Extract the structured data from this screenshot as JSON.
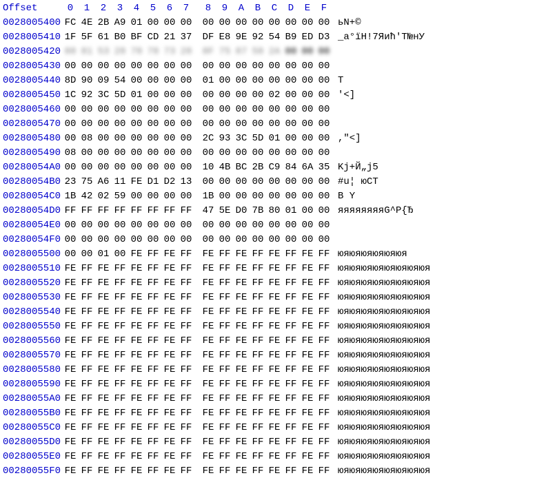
{
  "header": {
    "offset_label": "Offset",
    "cols": [
      "0",
      "1",
      "2",
      "3",
      "4",
      "5",
      "6",
      "7",
      "8",
      "9",
      "A",
      "B",
      "C",
      "D",
      "E",
      "F"
    ]
  },
  "rows": [
    {
      "offset": "0028005400",
      "bytes": [
        "FC",
        "4E",
        "2B",
        "A9",
        "01",
        "00",
        "00",
        "00",
        "00",
        "00",
        "00",
        "00",
        "00",
        "00",
        "00",
        "00"
      ],
      "ascii": "ьN+©",
      "blurred": false
    },
    {
      "offset": "0028005410",
      "bytes": [
        "1F",
        "5F",
        "61",
        "B0",
        "BF",
        "CD",
        "21",
        "37",
        "DF",
        "E8",
        "9E",
        "92",
        "54",
        "B9",
        "ED",
        "D3"
      ],
      "ascii": " _a°їН!7Яић'T№нУ",
      "blurred": false
    },
    {
      "offset": "0028005420",
      "bytes": [
        "88",
        "81",
        "53",
        "28",
        "78",
        "78",
        "73",
        "28",
        "8F",
        "75",
        "87",
        "58",
        "2A",
        "00",
        "00",
        "00"
      ],
      "ascii": "                ",
      "blurred": true
    },
    {
      "offset": "0028005430",
      "bytes": [
        "00",
        "00",
        "00",
        "00",
        "00",
        "00",
        "00",
        "00",
        "00",
        "00",
        "00",
        "00",
        "00",
        "00",
        "00",
        "00"
      ],
      "ascii": "",
      "blurred": false
    },
    {
      "offset": "0028005440",
      "bytes": [
        "8D",
        "90",
        "09",
        "54",
        "00",
        "00",
        "00",
        "00",
        "01",
        "00",
        "00",
        "00",
        "00",
        "00",
        "00",
        "00"
      ],
      "ascii": "   T",
      "blurred": false
    },
    {
      "offset": "0028005450",
      "bytes": [
        "1C",
        "92",
        "3C",
        "5D",
        "01",
        "00",
        "00",
        "00",
        "00",
        "00",
        "00",
        "00",
        "02",
        "00",
        "00",
        "00"
      ],
      "ascii": " '<]",
      "blurred": false
    },
    {
      "offset": "0028005460",
      "bytes": [
        "00",
        "00",
        "00",
        "00",
        "00",
        "00",
        "00",
        "00",
        "00",
        "00",
        "00",
        "00",
        "00",
        "00",
        "00",
        "00"
      ],
      "ascii": "",
      "blurred": false
    },
    {
      "offset": "0028005470",
      "bytes": [
        "00",
        "00",
        "00",
        "00",
        "00",
        "00",
        "00",
        "00",
        "00",
        "00",
        "00",
        "00",
        "00",
        "00",
        "00",
        "00"
      ],
      "ascii": "",
      "blurred": false
    },
    {
      "offset": "0028005480",
      "bytes": [
        "00",
        "08",
        "00",
        "00",
        "00",
        "00",
        "00",
        "00",
        "2C",
        "93",
        "3C",
        "5D",
        "01",
        "00",
        "00",
        "00"
      ],
      "ascii": "        ,\"<]",
      "blurred": false
    },
    {
      "offset": "0028005490",
      "bytes": [
        "08",
        "00",
        "00",
        "00",
        "00",
        "00",
        "00",
        "00",
        "00",
        "00",
        "00",
        "00",
        "00",
        "00",
        "00",
        "00"
      ],
      "ascii": "",
      "blurred": false
    },
    {
      "offset": "00280054A0",
      "bytes": [
        "00",
        "00",
        "00",
        "00",
        "00",
        "00",
        "00",
        "00",
        "10",
        "4B",
        "BC",
        "2B",
        "C9",
        "84",
        "6A",
        "35"
      ],
      "ascii": "         Kј+Й„j5",
      "blurred": false
    },
    {
      "offset": "00280054B0",
      "bytes": [
        "23",
        "75",
        "A6",
        "11",
        "FE",
        "D1",
        "D2",
        "13",
        "00",
        "00",
        "00",
        "00",
        "00",
        "00",
        "00",
        "00"
      ],
      "ascii": "#u¦ юСТ",
      "blurred": false
    },
    {
      "offset": "00280054C0",
      "bytes": [
        "1B",
        "42",
        "02",
        "59",
        "00",
        "00",
        "00",
        "00",
        "1B",
        "00",
        "00",
        "00",
        "00",
        "00",
        "00",
        "00"
      ],
      "ascii": " B Y",
      "blurred": false
    },
    {
      "offset": "00280054D0",
      "bytes": [
        "FF",
        "FF",
        "FF",
        "FF",
        "FF",
        "FF",
        "FF",
        "FF",
        "47",
        "5E",
        "D0",
        "7B",
        "80",
        "01",
        "00",
        "00"
      ],
      "ascii": "яяяяяяяяG^Р{Ђ",
      "blurred": false
    },
    {
      "offset": "00280054E0",
      "bytes": [
        "00",
        "00",
        "00",
        "00",
        "00",
        "00",
        "00",
        "00",
        "00",
        "00",
        "00",
        "00",
        "00",
        "00",
        "00",
        "00"
      ],
      "ascii": "",
      "blurred": false
    },
    {
      "offset": "00280054F0",
      "bytes": [
        "00",
        "00",
        "00",
        "00",
        "00",
        "00",
        "00",
        "00",
        "00",
        "00",
        "00",
        "00",
        "00",
        "00",
        "00",
        "00"
      ],
      "ascii": "",
      "blurred": false
    },
    {
      "offset": "0028005500",
      "bytes": [
        "00",
        "00",
        "01",
        "00",
        "FE",
        "FF",
        "FE",
        "FF",
        "FE",
        "FF",
        "FE",
        "FF",
        "FE",
        "FF",
        "FE",
        "FF"
      ],
      "ascii": "    юяюяюяюяюяюя",
      "blurred": false
    },
    {
      "offset": "0028005510",
      "bytes": [
        "FE",
        "FF",
        "FE",
        "FF",
        "FE",
        "FF",
        "FE",
        "FF",
        "FE",
        "FF",
        "FE",
        "FF",
        "FE",
        "FF",
        "FE",
        "FF"
      ],
      "ascii": "юяюяюяюяюяюяюяюя",
      "blurred": false
    },
    {
      "offset": "0028005520",
      "bytes": [
        "FE",
        "FF",
        "FE",
        "FF",
        "FE",
        "FF",
        "FE",
        "FF",
        "FE",
        "FF",
        "FE",
        "FF",
        "FE",
        "FF",
        "FE",
        "FF"
      ],
      "ascii": "юяюяюяюяюяюяюяюя",
      "blurred": false
    },
    {
      "offset": "0028005530",
      "bytes": [
        "FE",
        "FF",
        "FE",
        "FF",
        "FE",
        "FF",
        "FE",
        "FF",
        "FE",
        "FF",
        "FE",
        "FF",
        "FE",
        "FF",
        "FE",
        "FF"
      ],
      "ascii": "юяюяюяюяюяюяюяюя",
      "blurred": false
    },
    {
      "offset": "0028005540",
      "bytes": [
        "FE",
        "FF",
        "FE",
        "FF",
        "FE",
        "FF",
        "FE",
        "FF",
        "FE",
        "FF",
        "FE",
        "FF",
        "FE",
        "FF",
        "FE",
        "FF"
      ],
      "ascii": "юяюяюяюяюяюяюяюя",
      "blurred": false
    },
    {
      "offset": "0028005550",
      "bytes": [
        "FE",
        "FF",
        "FE",
        "FF",
        "FE",
        "FF",
        "FE",
        "FF",
        "FE",
        "FF",
        "FE",
        "FF",
        "FE",
        "FF",
        "FE",
        "FF"
      ],
      "ascii": "юяюяюяюяюяюяюяюя",
      "blurred": false
    },
    {
      "offset": "0028005560",
      "bytes": [
        "FE",
        "FF",
        "FE",
        "FF",
        "FE",
        "FF",
        "FE",
        "FF",
        "FE",
        "FF",
        "FE",
        "FF",
        "FE",
        "FF",
        "FE",
        "FF"
      ],
      "ascii": "юяюяюяюяюяюяюяюя",
      "blurred": false
    },
    {
      "offset": "0028005570",
      "bytes": [
        "FE",
        "FF",
        "FE",
        "FF",
        "FE",
        "FF",
        "FE",
        "FF",
        "FE",
        "FF",
        "FE",
        "FF",
        "FE",
        "FF",
        "FE",
        "FF"
      ],
      "ascii": "юяюяюяюяюяюяюяюя",
      "blurred": false
    },
    {
      "offset": "0028005580",
      "bytes": [
        "FE",
        "FF",
        "FE",
        "FF",
        "FE",
        "FF",
        "FE",
        "FF",
        "FE",
        "FF",
        "FE",
        "FF",
        "FE",
        "FF",
        "FE",
        "FF"
      ],
      "ascii": "юяюяюяюяюяюяюяюя",
      "blurred": false
    },
    {
      "offset": "0028005590",
      "bytes": [
        "FE",
        "FF",
        "FE",
        "FF",
        "FE",
        "FF",
        "FE",
        "FF",
        "FE",
        "FF",
        "FE",
        "FF",
        "FE",
        "FF",
        "FE",
        "FF"
      ],
      "ascii": "юяюяюяюяюяюяюяюя",
      "blurred": false
    },
    {
      "offset": "00280055A0",
      "bytes": [
        "FE",
        "FF",
        "FE",
        "FF",
        "FE",
        "FF",
        "FE",
        "FF",
        "FE",
        "FF",
        "FE",
        "FF",
        "FE",
        "FF",
        "FE",
        "FF"
      ],
      "ascii": "юяюяюяюяюяюяюяюя",
      "blurred": false
    },
    {
      "offset": "00280055B0",
      "bytes": [
        "FE",
        "FF",
        "FE",
        "FF",
        "FE",
        "FF",
        "FE",
        "FF",
        "FE",
        "FF",
        "FE",
        "FF",
        "FE",
        "FF",
        "FE",
        "FF"
      ],
      "ascii": "юяюяюяюяюяюяюяюя",
      "blurred": false
    },
    {
      "offset": "00280055C0",
      "bytes": [
        "FE",
        "FF",
        "FE",
        "FF",
        "FE",
        "FF",
        "FE",
        "FF",
        "FE",
        "FF",
        "FE",
        "FF",
        "FE",
        "FF",
        "FE",
        "FF"
      ],
      "ascii": "юяюяюяюяюяюяюяюя",
      "blurred": false
    },
    {
      "offset": "00280055D0",
      "bytes": [
        "FE",
        "FF",
        "FE",
        "FF",
        "FE",
        "FF",
        "FE",
        "FF",
        "FE",
        "FF",
        "FE",
        "FF",
        "FE",
        "FF",
        "FE",
        "FF"
      ],
      "ascii": "юяюяюяюяюяюяюяюя",
      "blurred": false
    },
    {
      "offset": "00280055E0",
      "bytes": [
        "FE",
        "FF",
        "FE",
        "FF",
        "FE",
        "FF",
        "FE",
        "FF",
        "FE",
        "FF",
        "FE",
        "FF",
        "FE",
        "FF",
        "FE",
        "FF"
      ],
      "ascii": "юяюяюяюяюяюяюяюя",
      "blurred": false
    },
    {
      "offset": "00280055F0",
      "bytes": [
        "FE",
        "FF",
        "FE",
        "FF",
        "FE",
        "FF",
        "FE",
        "FF",
        "FE",
        "FF",
        "FE",
        "FF",
        "FE",
        "FF",
        "FE",
        "FF"
      ],
      "ascii": "юяюяюяюяюяюяюяюя",
      "blurred": false
    }
  ]
}
